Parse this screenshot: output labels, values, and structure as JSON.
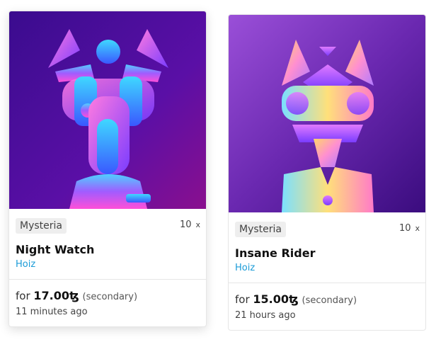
{
  "cards": [
    {
      "collection": "Mysteria",
      "quantity": "10",
      "quantity_suffix": "x",
      "name": "Night Watch",
      "creator": "Hoiz",
      "price_prefix": "for",
      "price": "17.00",
      "currency": "ꜩ",
      "sale_type": "(secondary)",
      "time_ago": "11 minutes ago"
    },
    {
      "collection": "Mysteria",
      "quantity": "10",
      "quantity_suffix": "x",
      "name": "Insane Rider",
      "creator": "Hoiz",
      "price_prefix": "for",
      "price": "15.00",
      "currency": "ꜩ",
      "sale_type": "(secondary)",
      "time_ago": "21 hours ago"
    }
  ],
  "colors": {
    "link": "#1a9bd7",
    "tag_bg": "#eeeeee",
    "art1_bg": "#3d0a8c",
    "art2_bg": "#5a1fa0"
  }
}
